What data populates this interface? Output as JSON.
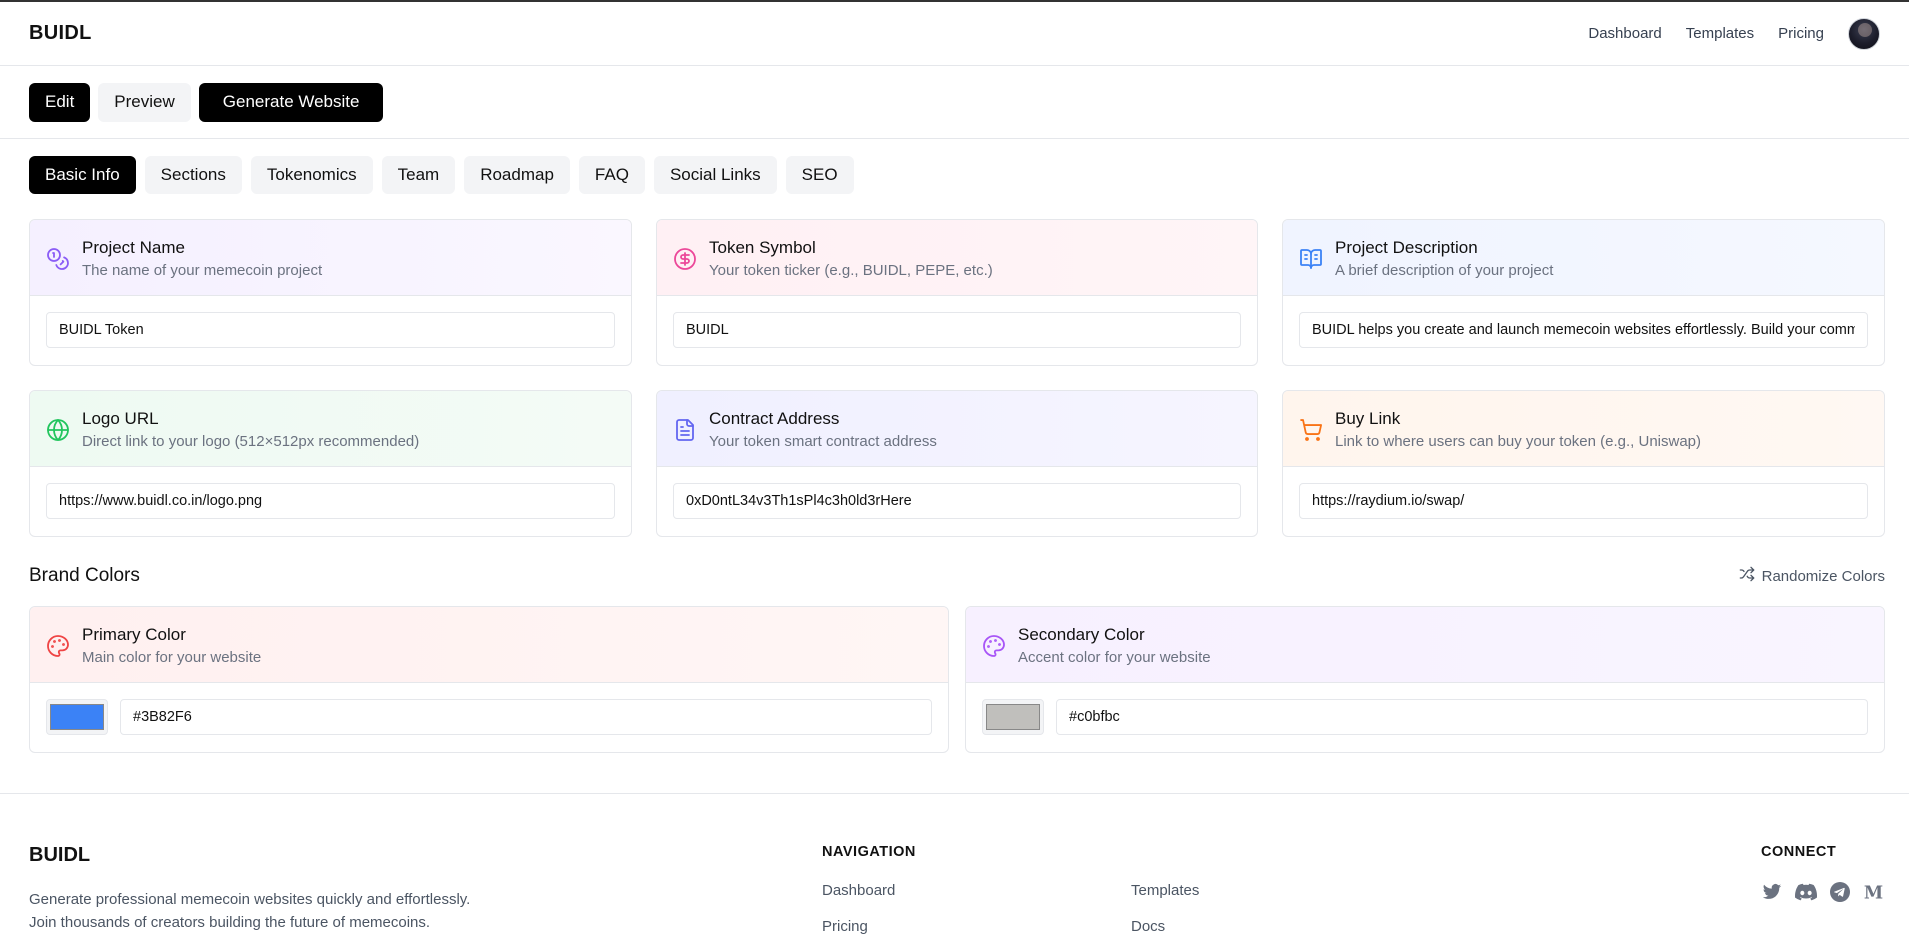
{
  "header": {
    "logo": "BUIDL",
    "nav": [
      "Dashboard",
      "Templates",
      "Pricing"
    ]
  },
  "toolbar": {
    "edit_label": "Edit",
    "preview_label": "Preview",
    "generate_label": "Generate Website"
  },
  "tabs": [
    "Basic Info",
    "Sections",
    "Tokenomics",
    "Team",
    "Roadmap",
    "FAQ",
    "Social Links",
    "SEO"
  ],
  "active_tab": "Basic Info",
  "fields": {
    "project_name": {
      "title": "Project Name",
      "desc": "The name of your memecoin project",
      "value": "BUIDL Token",
      "icon": "coins-icon"
    },
    "token_symbol": {
      "title": "Token Symbol",
      "desc": "Your token ticker (e.g., BUIDL, PEPE, etc.)",
      "value": "BUIDL",
      "icon": "dollar-circle-icon"
    },
    "project_description": {
      "title": "Project Description",
      "desc": "A brief description of your project",
      "value": "BUIDL helps you create and launch memecoin websites effortlessly. Build your community with professional templates.",
      "icon": "book-open-icon"
    },
    "logo_url": {
      "title": "Logo URL",
      "desc": "Direct link to your logo (512×512px recommended)",
      "value": "https://www.buidl.co.in/logo.png",
      "icon": "globe-icon"
    },
    "contract_address": {
      "title": "Contract Address",
      "desc": "Your token smart contract address",
      "value": "0xD0ntL34v3Th1sPl4c3h0ld3rHere",
      "icon": "document-icon"
    },
    "buy_link": {
      "title": "Buy Link",
      "desc": "Link to where users can buy your token (e.g., Uniswap)",
      "value": "https://raydium.io/swap/",
      "icon": "cart-icon"
    }
  },
  "brand_colors": {
    "title": "Brand Colors",
    "randomize_label": "Randomize Colors",
    "primary": {
      "title": "Primary Color",
      "desc": "Main color for your website",
      "value": "#3B82F6",
      "swatch": "#3B82F6"
    },
    "secondary": {
      "title": "Secondary Color",
      "desc": "Accent color for your website",
      "value": "#c0bfbc",
      "swatch": "#c0bfbc"
    }
  },
  "footer": {
    "logo": "BUIDL",
    "text_line1": "Generate professional memecoin websites quickly and effortlessly.",
    "text_line2": "Join thousands of creators building the future of memecoins.",
    "nav_heading": "NAVIGATION",
    "nav_links": [
      "Dashboard",
      "Templates",
      "Pricing",
      "Docs"
    ],
    "connect_heading": "CONNECT",
    "social_icons": [
      "twitter-icon",
      "discord-icon",
      "telegram-icon",
      "medium-icon"
    ]
  },
  "colors": {
    "accent_dark": "#000000",
    "icon_purple": "#8b5cf6",
    "icon_pink": "#ec4899",
    "icon_blue": "#3b82f6",
    "icon_green": "#22c55e",
    "icon_indigo": "#6366f1",
    "icon_orange": "#f97316",
    "icon_red": "#ef4444"
  }
}
